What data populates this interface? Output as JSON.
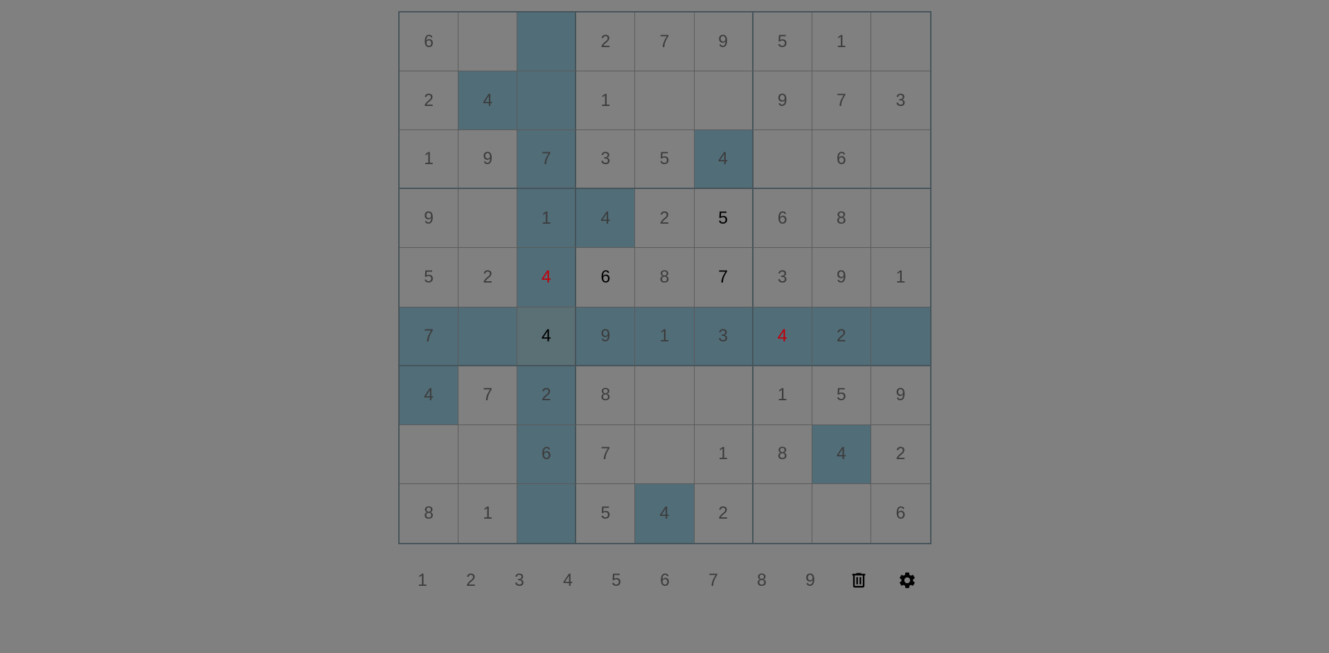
{
  "board": {
    "cells": [
      [
        "6",
        "",
        "",
        "2",
        "7",
        "9",
        "5",
        "1",
        ""
      ],
      [
        "2",
        "4",
        "",
        "1",
        "",
        "",
        "9",
        "7",
        "3"
      ],
      [
        "1",
        "9",
        "7",
        "3",
        "5",
        "4",
        "",
        "6",
        ""
      ],
      [
        "9",
        "",
        "1",
        "4",
        "2",
        "5",
        "6",
        "8",
        ""
      ],
      [
        "5",
        "2",
        "4",
        "6",
        "8",
        "7",
        "3",
        "9",
        "1"
      ],
      [
        "7",
        "",
        "4",
        "9",
        "1",
        "3",
        "4",
        "2",
        ""
      ],
      [
        "4",
        "7",
        "2",
        "8",
        "",
        "",
        "1",
        "5",
        "9"
      ],
      [
        "",
        "",
        "6",
        "7",
        "",
        "1",
        "8",
        "4",
        "2"
      ],
      [
        "8",
        "1",
        "",
        "5",
        "4",
        "2",
        "",
        "",
        "6"
      ]
    ],
    "selected": [
      5,
      2
    ],
    "highlighted_cells": [
      [
        0,
        2
      ],
      [
        1,
        1
      ],
      [
        1,
        2
      ],
      [
        2,
        2
      ],
      [
        2,
        5
      ],
      [
        3,
        2
      ],
      [
        3,
        3
      ],
      [
        4,
        2
      ],
      [
        5,
        0
      ],
      [
        5,
        1
      ],
      [
        5,
        3
      ],
      [
        5,
        4
      ],
      [
        5,
        5
      ],
      [
        5,
        6
      ],
      [
        5,
        7
      ],
      [
        5,
        8
      ],
      [
        6,
        0
      ],
      [
        6,
        2
      ],
      [
        7,
        2
      ],
      [
        7,
        7
      ],
      [
        8,
        2
      ],
      [
        8,
        4
      ]
    ],
    "user_entered_cells": [
      [
        3,
        5
      ],
      [
        4,
        3
      ],
      [
        4,
        5
      ],
      [
        5,
        2
      ]
    ],
    "error_cells": [
      [
        4,
        2
      ],
      [
        5,
        6
      ]
    ]
  },
  "numpad": {
    "numbers": [
      "1",
      "2",
      "3",
      "4",
      "5",
      "6",
      "7",
      "8",
      "9"
    ],
    "tools": [
      {
        "name": "delete",
        "icon": "trash-icon"
      },
      {
        "name": "settings",
        "icon": "gear-icon"
      }
    ]
  },
  "colors": {
    "background": "#808080",
    "highlight": "#516d78",
    "selected": "#5b7075",
    "given_text": "#3c3c3c",
    "user_text": "#000000",
    "error_text": "#c0000a"
  }
}
